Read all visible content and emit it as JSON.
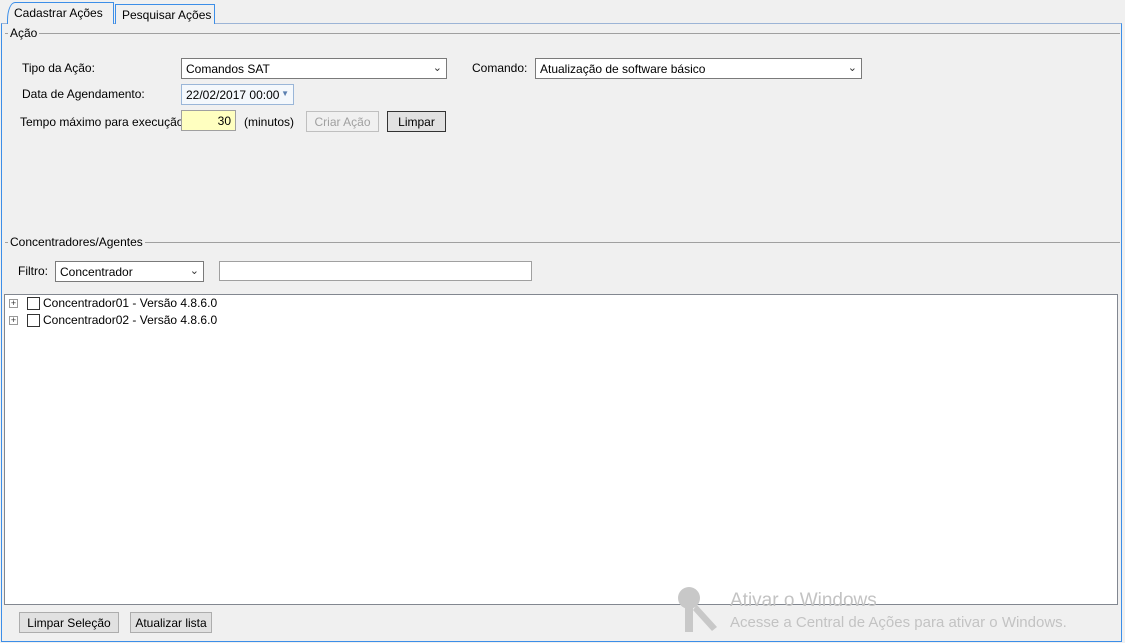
{
  "tabs": [
    {
      "label": "Cadastrar Ações",
      "active": true
    },
    {
      "label": "Pesquisar Ações",
      "active": false
    }
  ],
  "acao": {
    "legend": "Ação",
    "tipo_label": "Tipo da Ação:",
    "tipo_value": "Comandos SAT",
    "comando_label": "Comando:",
    "comando_value": "Atualização de software básico",
    "data_label": "Data de Agendamento:",
    "data_value": "22/02/2017 00:00",
    "tempo_label": "Tempo máximo para execução:",
    "tempo_value": "30",
    "tempo_unit": "(minutos)",
    "criar_button": "Criar Ação",
    "limpar_button": "Limpar"
  },
  "concentradores": {
    "legend": "Concentradores/Agentes",
    "filtro_label": "Filtro:",
    "filtro_value": "Concentrador",
    "filtro_text": "",
    "nodes": [
      {
        "label": "Concentrador01  - Versão 4.8.6.0"
      },
      {
        "label": "Concentrador02  - Versão 4.8.6.0"
      }
    ]
  },
  "bottom": {
    "limpar_selecao": "Limpar Seleção",
    "atualizar_lista": "Atualizar lista"
  },
  "watermark": {
    "title": "Ativar o Windows",
    "subtitle": "Acesse a Central de Ações para ativar o Windows."
  }
}
